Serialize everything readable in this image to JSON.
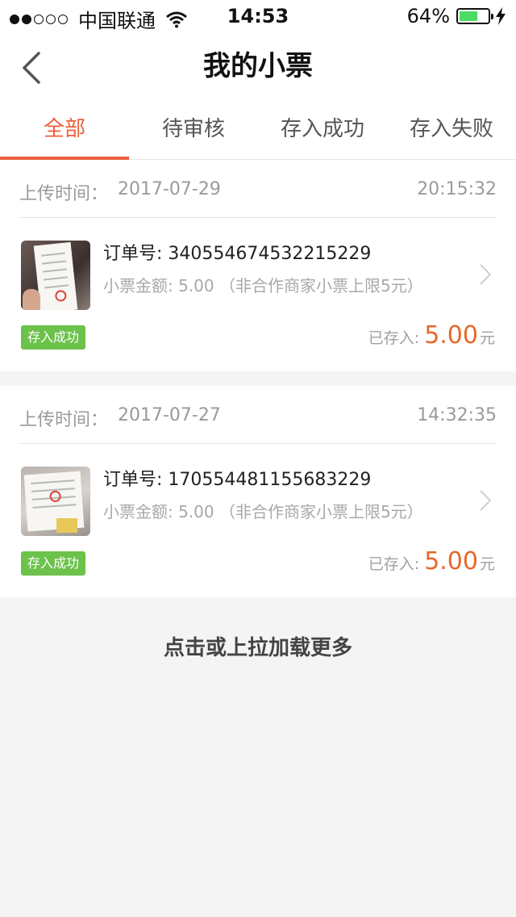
{
  "status_bar": {
    "carrier": "中国联通",
    "time": "14:53",
    "battery": "64%",
    "battery_level": 0.64
  },
  "nav": {
    "title": "我的小票"
  },
  "tabs": [
    {
      "label": "全部",
      "active": true
    },
    {
      "label": "待审核",
      "active": false
    },
    {
      "label": "存入成功",
      "active": false
    },
    {
      "label": "存入失败",
      "active": false
    }
  ],
  "receipts": [
    {
      "upload_label": "上传时间：",
      "upload_date": "2017-07-29",
      "upload_time": "20:15:32",
      "order_no": "订单号: 340554674532215229",
      "amount_line": "小票金额: 5.00 （非合作商家小票上限5元）",
      "status": "存入成功",
      "stored_label": "已存入:",
      "stored_amount": "5.00",
      "stored_unit": "元"
    },
    {
      "upload_label": "上传时间：",
      "upload_date": "2017-07-27",
      "upload_time": "14:32:35",
      "order_no": "订单号: 170554481155683229",
      "amount_line": "小票金额: 5.00 （非合作商家小票上限5元）",
      "status": "存入成功",
      "stored_label": "已存入:",
      "stored_amount": "5.00",
      "stored_unit": "元"
    }
  ],
  "load_more": "点击或上拉加载更多",
  "colors": {
    "accent": "#e8603c",
    "amount": "#e8672a",
    "badge_bg": "#6cc24a",
    "battery": "#4cd964"
  }
}
